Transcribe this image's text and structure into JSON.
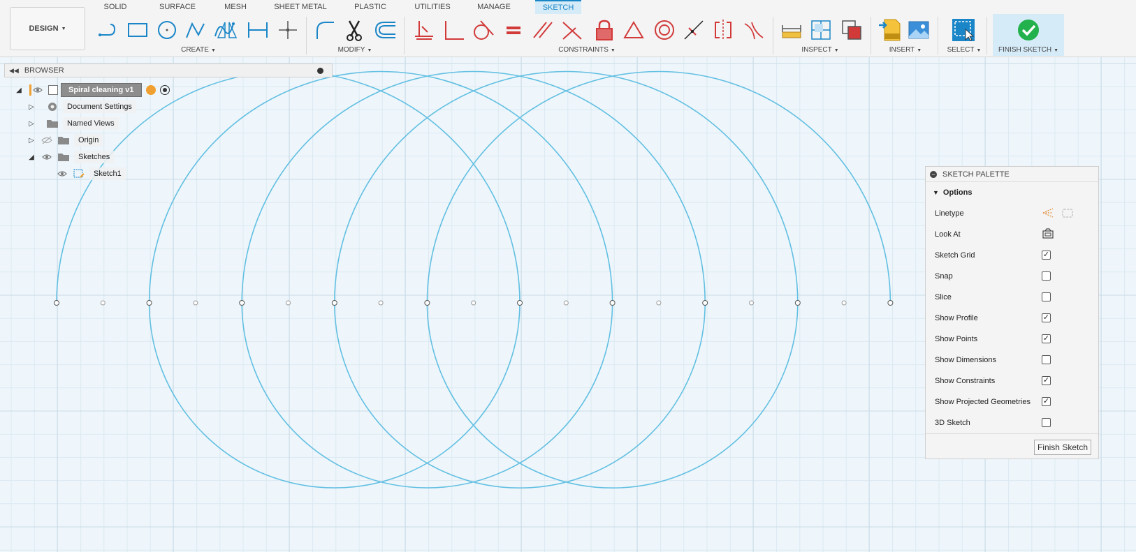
{
  "workspace": {
    "label": "DESIGN"
  },
  "tabs": [
    "SOLID",
    "SURFACE",
    "MESH",
    "SHEET METAL",
    "PLASTIC",
    "UTILITIES",
    "MANAGE",
    "SKETCH"
  ],
  "active_tab": "SKETCH",
  "groups": {
    "create": "CREATE",
    "modify": "MODIFY",
    "constraints": "CONSTRAINTS",
    "inspect": "INSPECT",
    "insert": "INSERT",
    "select": "SELECT",
    "finish": "FINISH SKETCH"
  },
  "browser": {
    "title": "BROWSER",
    "root": "Spiral cleaning v1",
    "items": [
      "Document Settings",
      "Named Views",
      "Origin",
      "Sketches",
      "Sketch1"
    ]
  },
  "palette": {
    "title": "SKETCH PALETTE",
    "section": "Options",
    "linetype": "Linetype",
    "look_at": "Look At",
    "options": [
      {
        "label": "Sketch Grid",
        "checked": true
      },
      {
        "label": "Snap",
        "checked": false
      },
      {
        "label": "Slice",
        "checked": false
      },
      {
        "label": "Show Profile",
        "checked": true
      },
      {
        "label": "Show Points",
        "checked": true
      },
      {
        "label": "Show Dimensions",
        "checked": false
      },
      {
        "label": "Show Constraints",
        "checked": true
      },
      {
        "label": "Show Projected Geometries",
        "checked": true
      },
      {
        "label": "3D Sketch",
        "checked": false
      }
    ],
    "finish_button": "Finish Sketch"
  },
  "colors": {
    "sketch_curve": "#62bfe2",
    "accent": "#1a86c8",
    "constraint_red": "#d23a3a",
    "finish_green": "#22b14c"
  }
}
